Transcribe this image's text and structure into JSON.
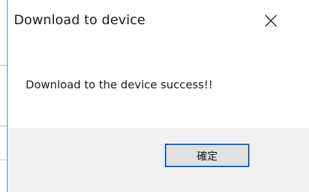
{
  "dialog": {
    "title": "Download to device",
    "message": "Download to the device success!!",
    "ok_label": "確定",
    "close_glyph": "✕"
  },
  "colors": {
    "border_accent": "#3c8ad8",
    "footer_bg": "#f0f0f0",
    "button_bg": "#e1e1e1",
    "button_focus_border": "#0a64c8"
  },
  "icons": {
    "close": "close-icon"
  }
}
